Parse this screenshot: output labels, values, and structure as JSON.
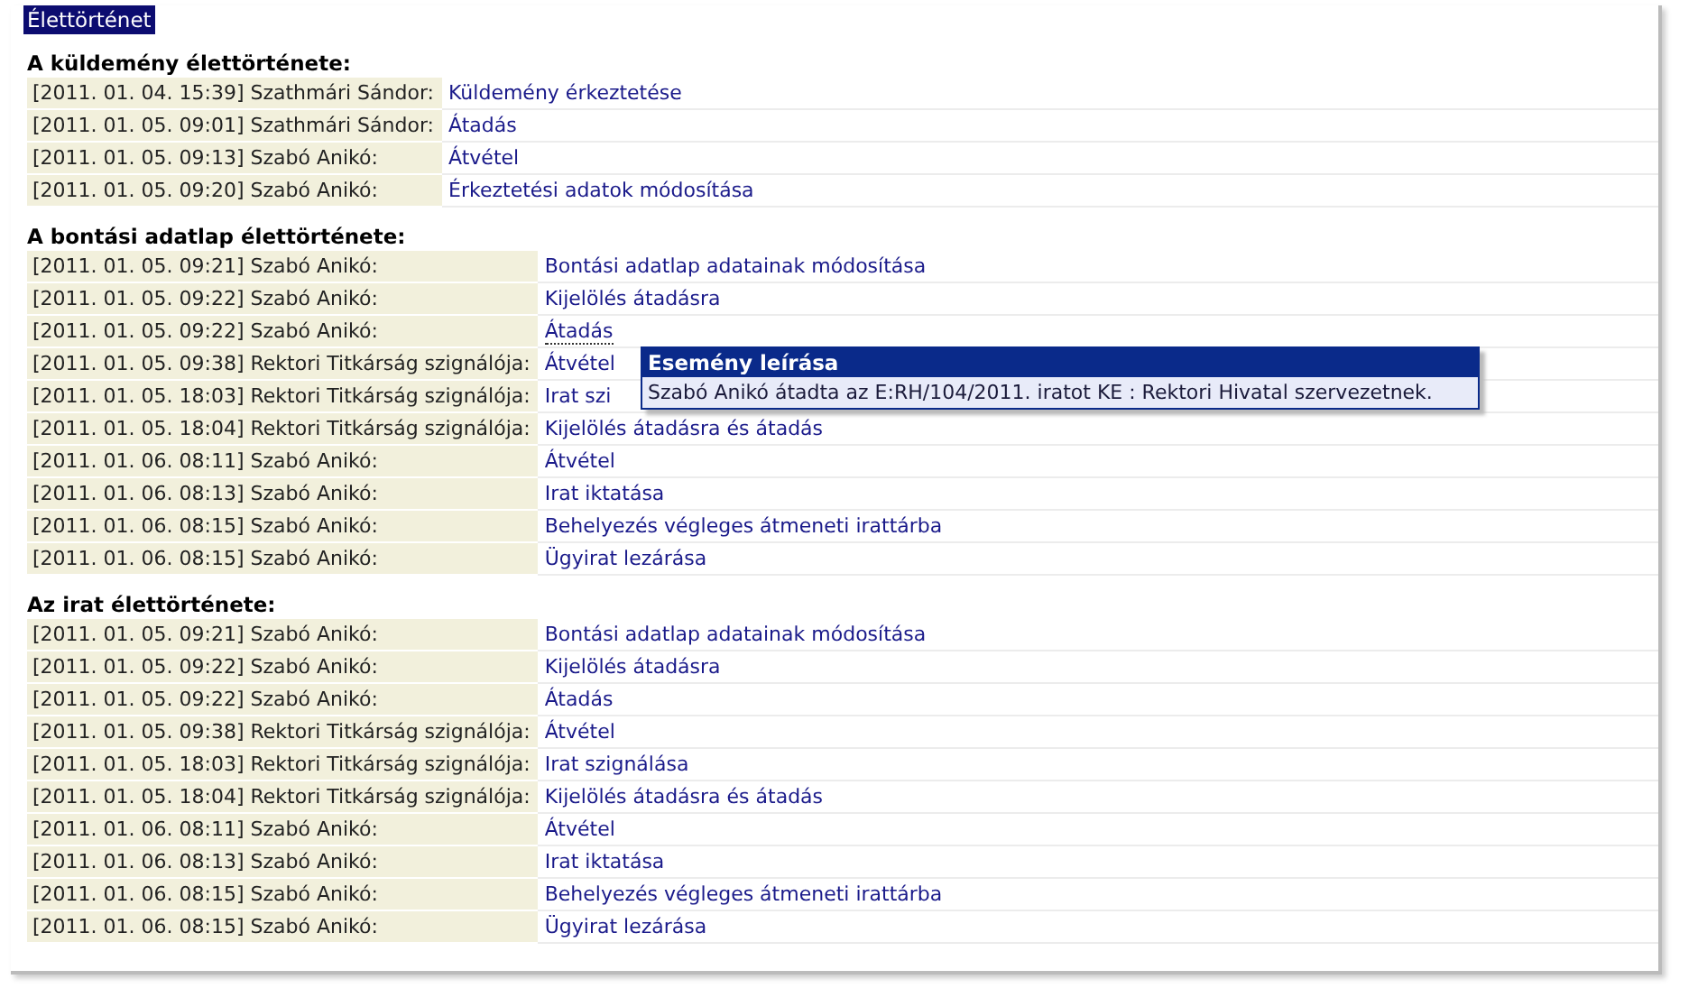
{
  "title": "Élettörténet",
  "sections": [
    {
      "heading": "A küldemény élettörténete:",
      "events": [
        {
          "stamp": "[2011. 01. 04. 15:39] Szathmári Sándor:",
          "action": "Küldemény érkeztetése",
          "hovered": false
        },
        {
          "stamp": "[2011. 01. 05. 09:01] Szathmári Sándor:",
          "action": "Átadás",
          "hovered": false
        },
        {
          "stamp": "[2011. 01. 05. 09:13] Szabó Anikó:",
          "action": "Átvétel",
          "hovered": false
        },
        {
          "stamp": "[2011. 01. 05. 09:20] Szabó Anikó:",
          "action": "Érkeztetési adatok módosítása",
          "hovered": false
        }
      ]
    },
    {
      "heading": "A bontási adatlap élettörténete:",
      "events": [
        {
          "stamp": "[2011. 01. 05. 09:21] Szabó Anikó:",
          "action": "Bontási adatlap adatainak módosítása",
          "hovered": false
        },
        {
          "stamp": "[2011. 01. 05. 09:22] Szabó Anikó:",
          "action": "Kijelölés átadásra",
          "hovered": false
        },
        {
          "stamp": "[2011. 01. 05. 09:22] Szabó Anikó:",
          "action": "Átadás",
          "hovered": true
        },
        {
          "stamp": "[2011. 01. 05. 09:38] Rektori Titkárság szignálója:",
          "action": "Átvétel",
          "hovered": false
        },
        {
          "stamp": "[2011. 01. 05. 18:03] Rektori Titkárság szignálója:",
          "action": "Irat szi",
          "hovered": false
        },
        {
          "stamp": "[2011. 01. 05. 18:04] Rektori Titkárság szignálója:",
          "action": "Kijelölés átadásra és átadás",
          "hovered": false
        },
        {
          "stamp": "[2011. 01. 06. 08:11] Szabó Anikó:",
          "action": "Átvétel",
          "hovered": false
        },
        {
          "stamp": "[2011. 01. 06. 08:13] Szabó Anikó:",
          "action": "Irat iktatása",
          "hovered": false
        },
        {
          "stamp": "[2011. 01. 06. 08:15] Szabó Anikó:",
          "action": "Behelyezés végleges átmeneti irattárba",
          "hovered": false
        },
        {
          "stamp": "[2011. 01. 06. 08:15] Szabó Anikó:",
          "action": "Ügyirat lezárása",
          "hovered": false
        }
      ]
    },
    {
      "heading": "Az irat élettörténete:",
      "events": [
        {
          "stamp": "[2011. 01. 05. 09:21] Szabó Anikó:",
          "action": "Bontási adatlap adatainak módosítása",
          "hovered": false
        },
        {
          "stamp": "[2011. 01. 05. 09:22] Szabó Anikó:",
          "action": "Kijelölés átadásra",
          "hovered": false
        },
        {
          "stamp": "[2011. 01. 05. 09:22] Szabó Anikó:",
          "action": "Átadás",
          "hovered": false
        },
        {
          "stamp": "[2011. 01. 05. 09:38] Rektori Titkárság szignálója:",
          "action": "Átvétel",
          "hovered": false
        },
        {
          "stamp": "[2011. 01. 05. 18:03] Rektori Titkárság szignálója:",
          "action": "Irat szignálása",
          "hovered": false
        },
        {
          "stamp": "[2011. 01. 05. 18:04] Rektori Titkárság szignálója:",
          "action": "Kijelölés átadásra és átadás",
          "hovered": false
        },
        {
          "stamp": "[2011. 01. 06. 08:11] Szabó Anikó:",
          "action": "Átvétel",
          "hovered": false
        },
        {
          "stamp": "[2011. 01. 06. 08:13] Szabó Anikó:",
          "action": "Irat iktatása",
          "hovered": false
        },
        {
          "stamp": "[2011. 01. 06. 08:15] Szabó Anikó:",
          "action": "Behelyezés végleges átmeneti irattárba",
          "hovered": false
        },
        {
          "stamp": "[2011. 01. 06. 08:15] Szabó Anikó:",
          "action": "Ügyirat lezárása",
          "hovered": false
        }
      ]
    }
  ],
  "tooltip": {
    "title": "Esemény leírása",
    "text": "Szabó Anikó átadta az E:RH/104/2011. iratot KE : Rektori Hivatal szervezetnek."
  }
}
